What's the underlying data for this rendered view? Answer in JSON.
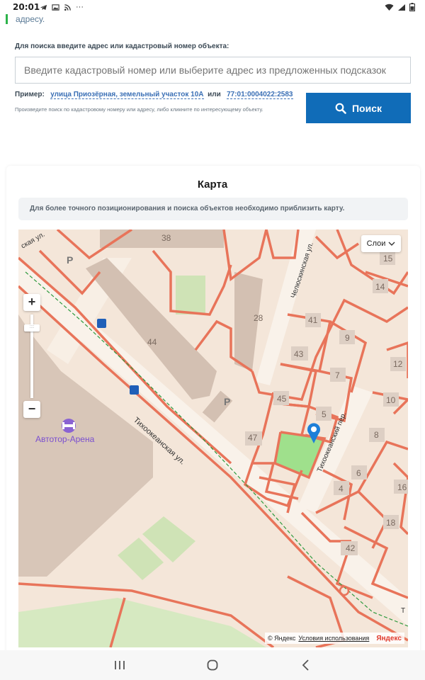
{
  "status_bar": {
    "time": "20:01",
    "more": "···"
  },
  "previous_text": "адресу.",
  "search": {
    "label": "Для поиска введите адрес или кадастровый номер объекта:",
    "placeholder": "Введите кадастровый номер или выберите адрес из предложенных подсказок",
    "example_prefix": "Пример:",
    "example_address": "улица Приозёрная, земельный участок 10А",
    "example_or": "или",
    "example_cadastral": "77:01:0004022:2583",
    "hint": "Произведите поиск по кадастровому номеру или адресу, либо кликните по интересующему объекту.",
    "button_label": "Поиск"
  },
  "map_card": {
    "title": "Карта",
    "info": "Для более точного позиционирования и поиска объектов необходимо приблизить карту.",
    "layers_label": "Слои",
    "zoom_in": "+",
    "zoom_out": "−",
    "attribution_copy": "© Яндекс",
    "attribution_terms": "Условия использования",
    "attribution_logo": "Яндекс",
    "streets": {
      "pacific_street": "Тихоокеанская ул.",
      "pacific_lane": "Тихоокеанский пер.",
      "chelyuskin_street": "Челюскинская ул.",
      "cut_street": "ская ул.",
      "edge_t": "Т"
    },
    "poi": {
      "arena": "Автотор-Арена"
    },
    "parking": "P",
    "house_numbers": {
      "h38": "38",
      "h44": "44",
      "h28": "28",
      "h41": "41",
      "h9": "9",
      "h43": "43",
      "h7": "7",
      "h12": "12",
      "h45": "45",
      "h5": "5",
      "h10": "10",
      "h8": "8",
      "h47": "47",
      "h6": "6",
      "h4": "4",
      "h16": "16",
      "h18": "18",
      "h42": "42",
      "h15": "15",
      "h14": "14"
    },
    "colors": {
      "parcel": "#e8745a",
      "building": "#d9c8bb",
      "green": "#cfe6b4",
      "selected": "#9fe08c",
      "road": "#f7efe7",
      "pin": "#1e7fd8"
    }
  },
  "nav": {
    "recent": "recent-apps",
    "home": "home",
    "back": "back"
  }
}
